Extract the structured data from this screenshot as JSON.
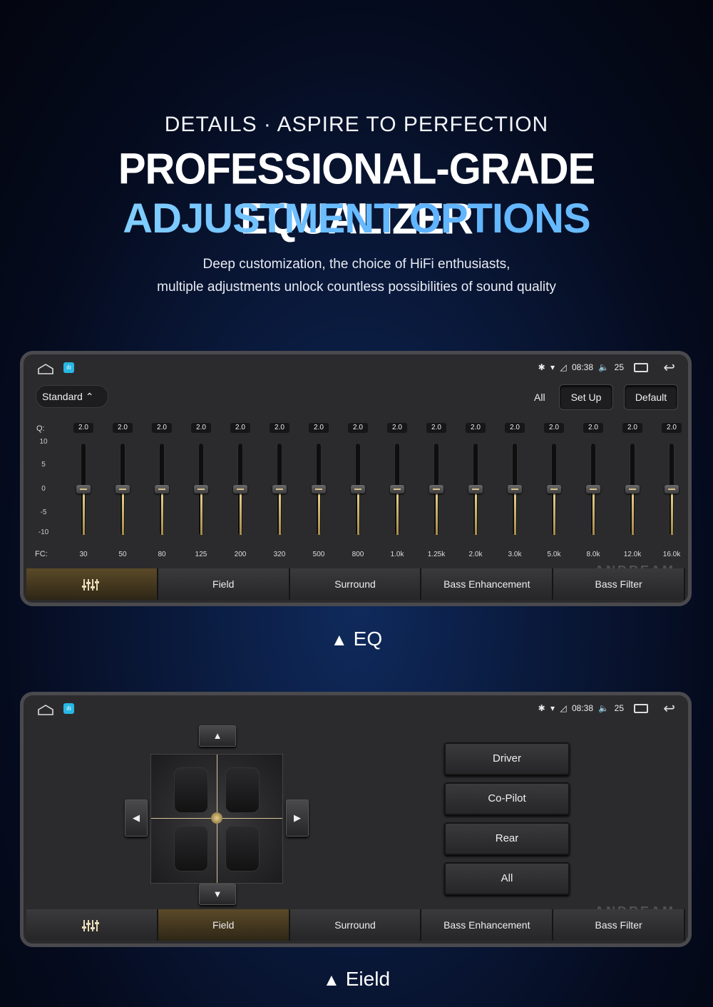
{
  "header": {
    "subtitle": "DETAILS · ASPIRE TO PERFECTION",
    "title_line1": "PROFESSIONAL-GRADE EQUALIZER",
    "title_line2": "ADJUSTMENT OPTIONS",
    "description_line1": "Deep customization, the choice of HiFi enthusiasts,",
    "description_line2": "multiple adjustments unlock countless possibilities of sound quality"
  },
  "status": {
    "time": "08:38",
    "volume": "25"
  },
  "eq_panel": {
    "preset": "Standard",
    "all_label": "All",
    "setup_label": "Set Up",
    "default_label": "Default",
    "q_label": "Q:",
    "fc_label": "FC:",
    "scale": [
      "10",
      "5",
      "0",
      "-5",
      "-10"
    ],
    "bands": [
      {
        "q": "2.0",
        "fc": "30",
        "gain": 0
      },
      {
        "q": "2.0",
        "fc": "50",
        "gain": 0
      },
      {
        "q": "2.0",
        "fc": "80",
        "gain": 0
      },
      {
        "q": "2.0",
        "fc": "125",
        "gain": 0
      },
      {
        "q": "2.0",
        "fc": "200",
        "gain": 0
      },
      {
        "q": "2.0",
        "fc": "320",
        "gain": 0
      },
      {
        "q": "2.0",
        "fc": "500",
        "gain": 0
      },
      {
        "q": "2.0",
        "fc": "800",
        "gain": 0
      },
      {
        "q": "2.0",
        "fc": "1.0k",
        "gain": 0
      },
      {
        "q": "2.0",
        "fc": "1.25k",
        "gain": 0
      },
      {
        "q": "2.0",
        "fc": "2.0k",
        "gain": 0
      },
      {
        "q": "2.0",
        "fc": "3.0k",
        "gain": 0
      },
      {
        "q": "2.0",
        "fc": "5.0k",
        "gain": 0
      },
      {
        "q": "2.0",
        "fc": "8.0k",
        "gain": 0
      },
      {
        "q": "2.0",
        "fc": "12.0k",
        "gain": 0
      },
      {
        "q": "2.0",
        "fc": "16.0k",
        "gain": 0
      }
    ],
    "caption": "EQ"
  },
  "tabs": [
    "Field",
    "Surround",
    "Bass Enhancement",
    "Bass Filter"
  ],
  "watermark": "ANDREAM",
  "field_panel": {
    "zones": [
      "Driver",
      "Co-Pilot",
      "Rear",
      "All"
    ],
    "caption": "Eield"
  },
  "colors": {
    "accent_gold": "#d8c08a",
    "title_blue": "#6fc0ff",
    "panel_bg": "#2b2b2d"
  }
}
